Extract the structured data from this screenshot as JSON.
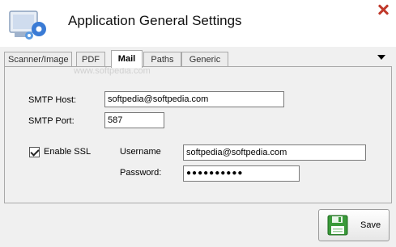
{
  "window": {
    "title": "Application General Settings"
  },
  "tabs": [
    {
      "label": "Scanner/Image"
    },
    {
      "label": "PDF"
    },
    {
      "label": "Mail"
    },
    {
      "label": "Paths"
    },
    {
      "label": "Generic"
    }
  ],
  "watermark": "www.softpedia.com",
  "mail": {
    "smtp_host_label": "SMTP Host:",
    "smtp_host_value": "softpedia@softpedia.com",
    "smtp_port_label": "SMTP Port:",
    "smtp_port_value": "587",
    "enable_ssl_label": "Enable SSL",
    "enable_ssl_checked": true,
    "username_label": "Username",
    "username_value": "softpedia@softpedia.com",
    "password_label": "Password:",
    "password_value": "●●●●●●●●●●"
  },
  "footer": {
    "save_label": "Save"
  },
  "icons": {
    "app": "settings-computer-icon",
    "close": "close-icon",
    "save": "floppy-disk-icon",
    "overflow": "triangle-down-icon"
  },
  "colors": {
    "save_icon": "#3a9a3a",
    "close": "#c0392b"
  }
}
